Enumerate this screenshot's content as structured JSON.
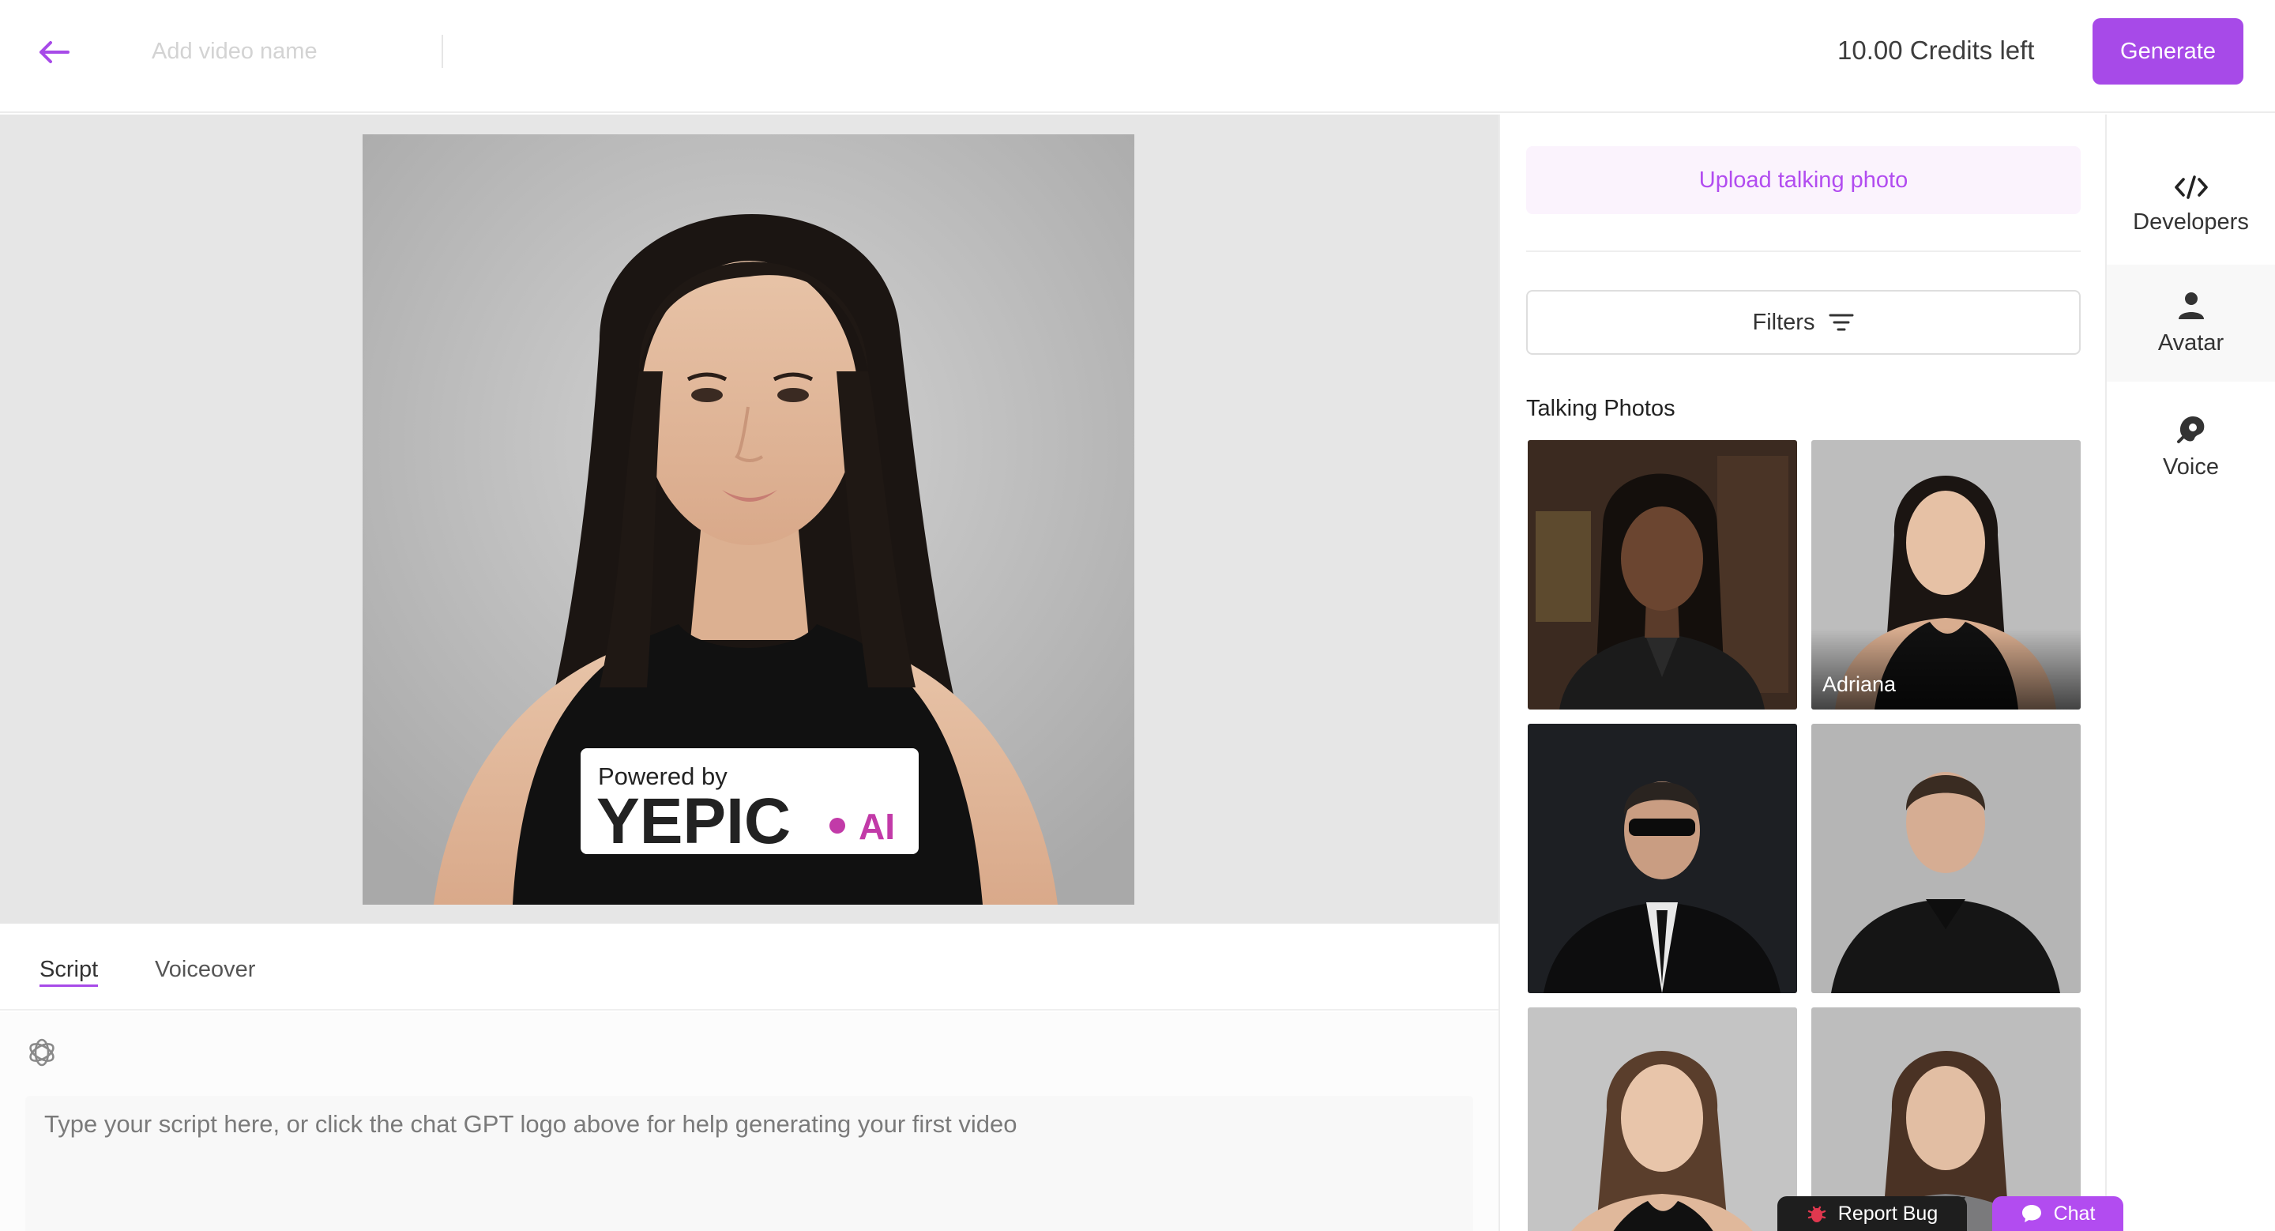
{
  "header": {
    "video_name_placeholder": "Add video name",
    "credits_label": "10.00 Credits left",
    "generate_label": "Generate"
  },
  "preview": {
    "watermark_powered_by": "Powered by",
    "watermark_brand": "YEPIC",
    "watermark_suffix": "AI"
  },
  "editor": {
    "tabs": [
      {
        "label": "Script",
        "active": true
      },
      {
        "label": "Voiceover",
        "active": false
      }
    ],
    "script_placeholder": "Type your script here, or click the chat GPT logo above for help generating your first video"
  },
  "panel": {
    "upload_label": "Upload talking photo",
    "filters_label": "Filters",
    "section_title": "Talking Photos",
    "photos": [
      {
        "label": ""
      },
      {
        "label": "Adriana"
      },
      {
        "label": ""
      },
      {
        "label": ""
      },
      {
        "label": ""
      },
      {
        "label": ""
      }
    ]
  },
  "rail": {
    "items": [
      {
        "label": "Developers",
        "icon": "code-icon"
      },
      {
        "label": "Avatar",
        "icon": "person-icon"
      },
      {
        "label": "Voice",
        "icon": "voice-icon"
      }
    ]
  },
  "footer": {
    "report_bug_label": "Report Bug",
    "chat_label": "Chat"
  },
  "colors": {
    "accent": "#a74ae8",
    "stage_bg": "#e6e6e6"
  }
}
